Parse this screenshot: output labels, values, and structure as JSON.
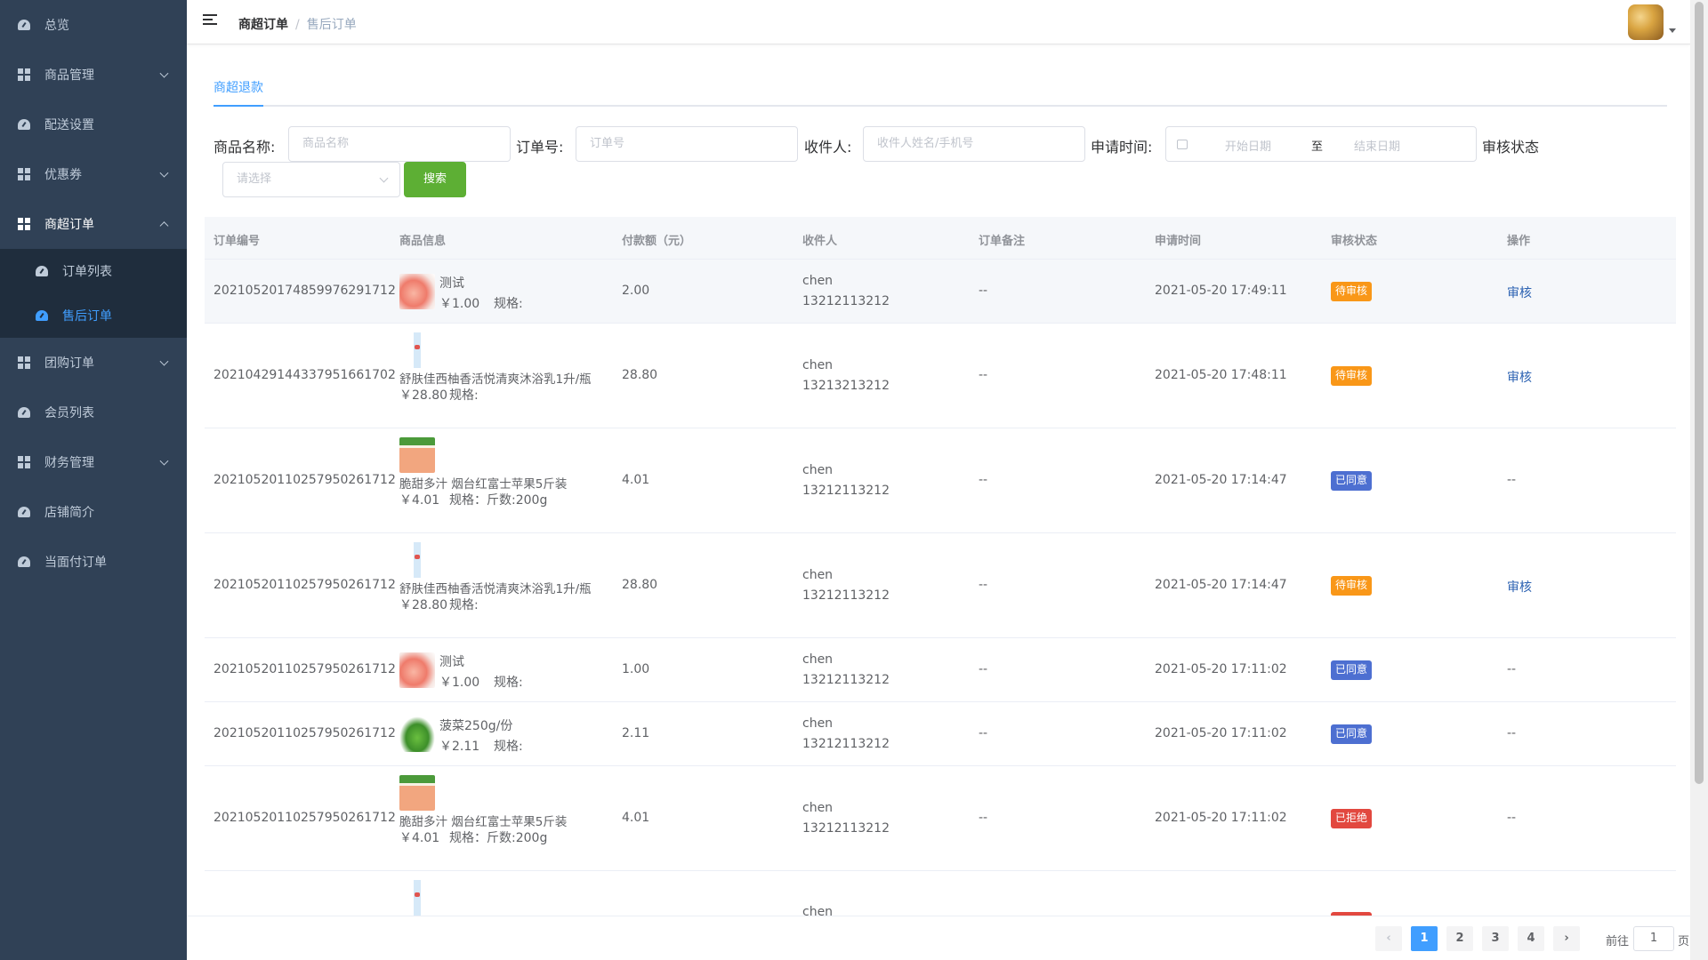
{
  "sidebar": {
    "items": [
      {
        "label": "总览",
        "icon": "dashboard-icon",
        "expandable": false
      },
      {
        "label": "商品管理",
        "icon": "grid-icon",
        "expandable": true
      },
      {
        "label": "配送设置",
        "icon": "dashboard-icon",
        "expandable": false
      },
      {
        "label": "优惠券",
        "icon": "grid-icon",
        "expandable": true
      },
      {
        "label": "商超订单",
        "icon": "grid-icon",
        "expandable": true,
        "open": true
      },
      {
        "label": "团购订单",
        "icon": "grid-icon",
        "expandable": true
      },
      {
        "label": "会员列表",
        "icon": "dashboard-icon",
        "expandable": false
      },
      {
        "label": "财务管理",
        "icon": "grid-icon",
        "expandable": true
      },
      {
        "label": "店铺简介",
        "icon": "dashboard-icon",
        "expandable": false
      },
      {
        "label": "当面付订单",
        "icon": "dashboard-icon",
        "expandable": false
      }
    ],
    "submenu": [
      {
        "label": "订单列表",
        "active": false
      },
      {
        "label": "售后订单",
        "active": true
      }
    ]
  },
  "breadcrumb": {
    "level1": "商超订单",
    "separator": "/",
    "level2": "售后订单"
  },
  "tabs": [
    {
      "label": "商超退款",
      "active": true
    }
  ],
  "filters": {
    "product_name_label": "商品名称:",
    "product_name_placeholder": "商品名称",
    "order_no_label": "订单号:",
    "order_no_placeholder": "订单号",
    "receiver_label": "收件人:",
    "receiver_placeholder": "收件人姓名/手机号",
    "apply_time_label": "申请时间:",
    "start_date_placeholder": "开始日期",
    "range_separator": "至",
    "end_date_placeholder": "结束日期",
    "status_label": "审核状态",
    "status_placeholder": "请选择",
    "search_button": "搜索"
  },
  "table": {
    "headers": [
      "订单编号",
      "商品信息",
      "付款额（元）",
      "收件人",
      "订单备注",
      "申请时间",
      "审核状态",
      "操作"
    ],
    "rows": [
      {
        "order_no": "2021052017485997629171​2",
        "image": "peach",
        "product": "测试",
        "price": "￥1.00",
        "spec": "规格:",
        "amount": "2.00",
        "name": "chen",
        "phone": "13212113212",
        "remark": "--",
        "time": "2021-05-20 17:49:11",
        "status": "待审核",
        "status_type": "pending",
        "action": "审核"
      },
      {
        "order_no": "20210429144337951661702",
        "image": "bottle",
        "product": "舒肤佳西柚香活悦清爽沐浴乳1升/瓶",
        "price": "￥28.80",
        "spec": "规格:",
        "amount": "28.80",
        "name": "chen",
        "phone": "13213213212",
        "remark": "--",
        "time": "2021-05-20 17:48:11",
        "status": "待审核",
        "status_type": "pending",
        "action": "审核"
      },
      {
        "order_no": "20210520110257950261712",
        "image": "apple",
        "product": "脆甜多汁 烟台红富士苹果5斤装",
        "price": "￥4.01",
        "spec": "规格：斤数:200g",
        "amount": "4.01",
        "name": "chen",
        "phone": "13212113212",
        "remark": "--",
        "time": "2021-05-20 17:14:47",
        "status": "已同意",
        "status_type": "agree",
        "action": "--"
      },
      {
        "order_no": "20210520110257950261712",
        "image": "bottle",
        "product": "舒肤佳西柚香活悦清爽沐浴乳1升/瓶",
        "price": "￥28.80",
        "spec": "规格:",
        "amount": "28.80",
        "name": "chen",
        "phone": "13212113212",
        "remark": "--",
        "time": "2021-05-20 17:14:47",
        "status": "待审核",
        "status_type": "pending",
        "action": "审核"
      },
      {
        "order_no": "20210520110257950261712",
        "image": "peach",
        "product": "测试",
        "price": "￥1.00",
        "spec": "规格:",
        "amount": "1.00",
        "name": "chen",
        "phone": "13212113212",
        "remark": "--",
        "time": "2021-05-20 17:11:02",
        "status": "已同意",
        "status_type": "agree",
        "action": "--"
      },
      {
        "order_no": "20210520110257950261712",
        "image": "veg",
        "product": "菠菜250g/份",
        "price": "￥2.11",
        "spec": "规格:",
        "amount": "2.11",
        "name": "chen",
        "phone": "13212113212",
        "remark": "--",
        "time": "2021-05-20 17:11:02",
        "status": "已同意",
        "status_type": "agree",
        "action": "--"
      },
      {
        "order_no": "20210520110257950261712",
        "image": "apple",
        "product": "脆甜多汁 烟台红富士苹果5斤装",
        "price": "￥4.01",
        "spec": "规格：斤数:200g",
        "amount": "4.01",
        "name": "chen",
        "phone": "13212113212",
        "remark": "--",
        "time": "2021-05-20 17:11:02",
        "status": "已拒绝",
        "status_type": "reject",
        "action": "--"
      }
    ],
    "partial_row": {
      "image": "bottle",
      "name": "chen"
    }
  },
  "pagination": {
    "pages": [
      "1",
      "2",
      "3",
      "4"
    ],
    "current": "1",
    "goto_label": "前往",
    "goto_value": "1",
    "page_suffix": "页"
  },
  "colors": {
    "sidebar_bg": "#304156",
    "accent": "#409eff",
    "search_btn": "#5daf34",
    "pending": "#f99718",
    "agree": "#4d6fd1",
    "reject": "#e2483f"
  }
}
